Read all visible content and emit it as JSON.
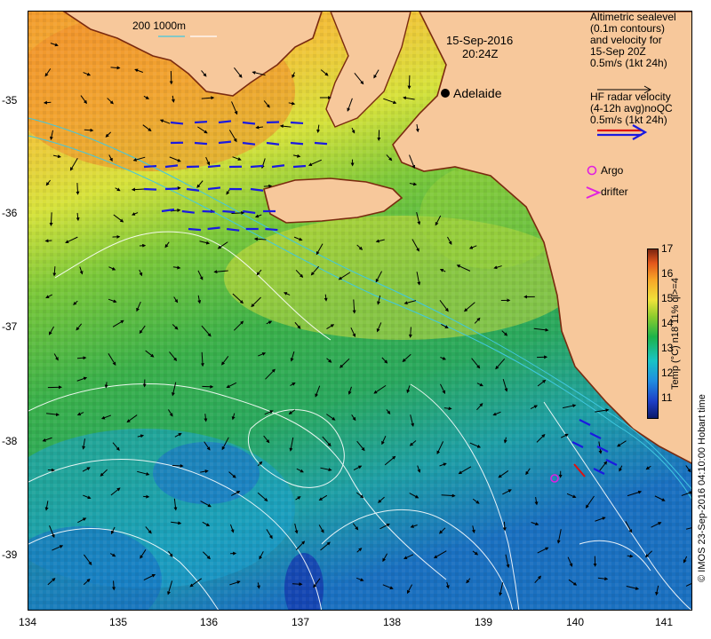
{
  "map": {
    "date": "15-Sep-2016",
    "time": "20:24Z",
    "city": "Adelaide",
    "depth_contours_label": "200  1000m",
    "legend_sealevel": [
      "Altimetric sealevel",
      "(0.1m contours)",
      "and velocity for",
      "15-Sep 20Z",
      "0.5m/s (1kt 24h)"
    ],
    "legend_hf": [
      "HF radar velocity",
      "(4-12h avg)noQC",
      "0.5m/s (1kt 24h)"
    ],
    "legend_argo": "Argo",
    "legend_drifter": "drifter",
    "x_ticks": [
      "134",
      "135",
      "136",
      "137",
      "138",
      "139",
      "140",
      "141"
    ],
    "y_ticks": [
      "-35",
      "-36",
      "-37",
      "-38",
      "-39"
    ],
    "colorbar_ticks": [
      "17",
      "16",
      "15",
      "14",
      "13",
      "12",
      "11"
    ],
    "colorbar_label": "Temp (°C) n18 11% ql>=4",
    "credit": "© IMOS 23-Sep-2016 04:10:00 Hobart time",
    "colors": {
      "land": "#f7c89b",
      "coast": "#7a2a10",
      "argo": "#e020e0",
      "hf_red": "#e01010",
      "hf_blue": "#1a1ae0",
      "contour": "#ffffff",
      "isobath": "#40c8e0"
    }
  }
}
